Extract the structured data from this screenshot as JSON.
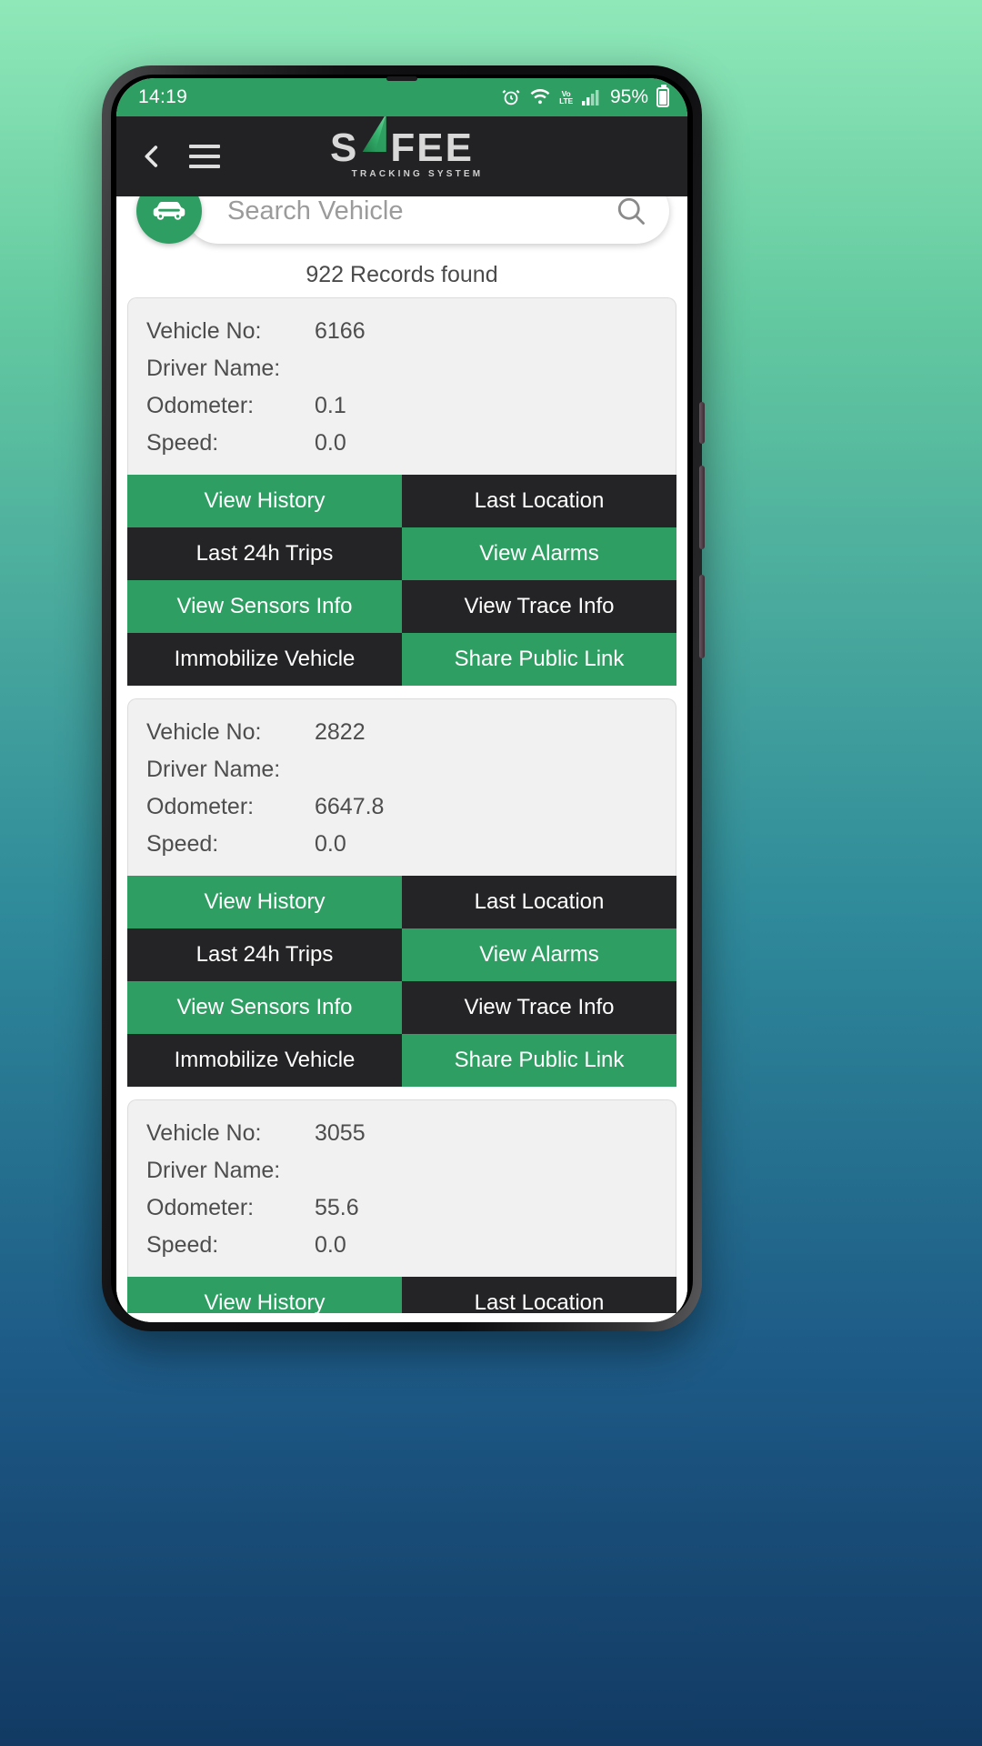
{
  "status_bar": {
    "time": "14:19",
    "battery_percent": "95%",
    "icons": [
      "alarm-icon",
      "wifi-icon",
      "volte-icon",
      "signal-icon",
      "battery-icon"
    ],
    "volte_top": "Vo",
    "volte_bottom": "LTE",
    "background_color": "#2f9e63"
  },
  "app_bar": {
    "back_label": "Back",
    "menu_label": "Menu",
    "logo_left": "S",
    "logo_right": "FEE",
    "logo_tagline": "TRACKING SYSTEM",
    "background_color": "#222224",
    "accent_color": "#2f9e63"
  },
  "search": {
    "placeholder": "Search Vehicle",
    "value": "",
    "vehicle_icon": "car-icon",
    "search_icon": "search-icon"
  },
  "results": {
    "count_text": "922 Records found"
  },
  "labels": {
    "vehicle_no": "Vehicle No:",
    "driver_name": "Driver Name:",
    "odometer": "Odometer:",
    "speed": "Speed:"
  },
  "actions": [
    {
      "label": "View History",
      "style": "green"
    },
    {
      "label": "Last Location",
      "style": "dark"
    },
    {
      "label": "Last 24h Trips",
      "style": "dark"
    },
    {
      "label": "View Alarms",
      "style": "green"
    },
    {
      "label": "View Sensors Info",
      "style": "green"
    },
    {
      "label": "View Trace Info",
      "style": "dark"
    },
    {
      "label": "Immobilize Vehicle",
      "style": "dark"
    },
    {
      "label": "Share Public Link",
      "style": "green"
    }
  ],
  "vehicles": [
    {
      "vehicle_no": "6166",
      "driver_name": "",
      "odometer": "0.1",
      "speed": "0.0"
    },
    {
      "vehicle_no": "2822",
      "driver_name": "",
      "odometer": "6647.8",
      "speed": "0.0"
    },
    {
      "vehicle_no": "3055",
      "driver_name": "",
      "odometer": "55.6",
      "speed": "0.0"
    }
  ]
}
